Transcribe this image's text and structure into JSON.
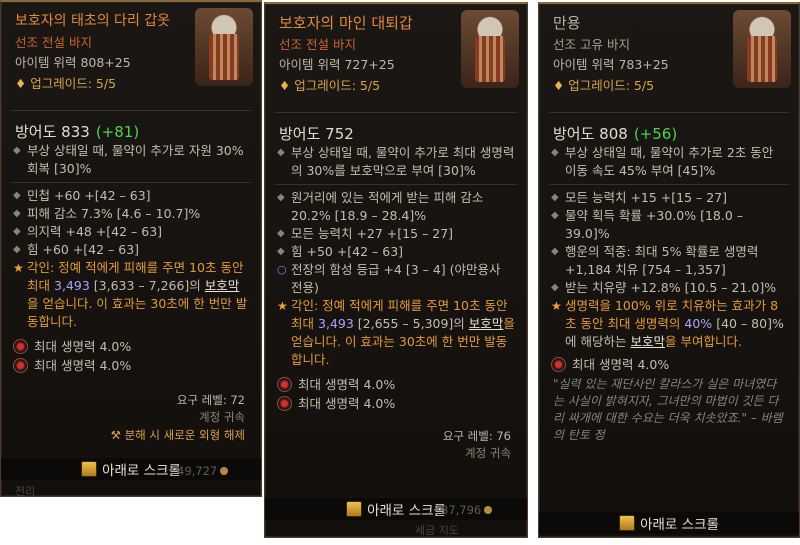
{
  "panels": [
    {
      "title": "보호자의 태초의 다리 갑옷",
      "subtitle": "선조 전설 바지",
      "item_power": "아이템 위력 808+25",
      "upgrade": "업그레이드: 5/5",
      "armor_label": "방어도 833",
      "armor_delta": "(+81)",
      "implicit": "부상 상태일 때, 물약이 추가로 자원 30% 회복 [30]%",
      "stats": [
        "민첩 +60 +[42 – 63]",
        "피해 감소 7.3% [4.6 – 10.7]%",
        "의지력 +48 +[42 – 63]",
        "힘 +60 +[42 – 63]"
      ],
      "temper_prefix": "각인: 정예 적에게 피해를 주면 10초 동안 최대",
      "temper_value": "3,493",
      "temper_range": "[3,633 – 7,266]의",
      "temper_shield": "보호막",
      "temper_suffix": "을 얻습니다. 이 효과는 30초에 한 번만 발동합니다.",
      "sockets": [
        "최대 생명력 4.0%",
        "최대 생명력 4.0%"
      ],
      "req_level": "요구 레벨: 72",
      "account_bound": "계정 귀속",
      "salvage": "분해 시 새로운 외형 해제",
      "scroll_label": "아래로 스크롤",
      "gold": "49,727"
    },
    {
      "title": "보호자의 마인 대퇴갑",
      "subtitle": "선조 전설 바지",
      "item_power": "아이템 위력 727+25",
      "upgrade": "업그레이드: 5/5",
      "armor_label": "방어도 752",
      "implicit": "부상 상태일 때, 물약이 추가로 최대 생명력의 30%를 보호막으로 부여 [30]%",
      "stats": [
        "원거리에 있는 적에게 받는 피해 감소 20.2% [18.9 – 28.4]%",
        "모든 능력치 +27 +[15 – 27]",
        "힘 +50 +[42 – 63]"
      ],
      "special_stat": "전장의 함성 등급 +4 [3 – 4] (야만용사 전용)",
      "temper_prefix": "각인: 정예 적에게 피해를 주면 10초 동안 최대",
      "temper_value": "3,493",
      "temper_range": "[2,655 – 5,309]의",
      "temper_shield": "보호막",
      "temper_suffix": "을 얻습니다. 이 효과는 30초에 한 번만 발동합니다.",
      "sockets": [
        "최대 생명력 4.0%",
        "최대 생명력 4.0%"
      ],
      "req_level": "요구 레벨: 76",
      "account_bound": "계정 귀속",
      "scroll_label": "아래로 스크롤",
      "gold": "37,796"
    },
    {
      "title": "만용",
      "subtitle": "선조 고유 바지",
      "item_power": "아이템 위력 783+25",
      "upgrade": "업그레이드: 5/5",
      "armor_label": "방어도 808",
      "armor_delta": "(+56)",
      "implicit": "부상 상태일 때, 물약이 추가로 2초 동안 이동 속도 45% 부여 [45]%",
      "stats": [
        "모든 능력치 +15 +[15 – 27]",
        "물약 획득 확률 +30.0% [18.0 – 39.0]%",
        "행운의 적중: 최대 5% 확률로 생명력 +1,184 치유 [754 – 1,357]",
        "받는 치유량 +12.8% [10.5 – 21.0]%"
      ],
      "unique_prefix": "생명력을 100% 위로 치유하는 효과가 8초 동안 최대 생명력의",
      "unique_value": "40%",
      "unique_range": "[40 – 80]%에 해당하는",
      "unique_shield": "보호막",
      "unique_suffix": "을 부여합니다.",
      "sockets": [
        "최대 생명력 4.0%"
      ],
      "flavor": "\"실력 있는 재단사인 칼라스가 실은 마녀였다는 사실이 밝혀지자, 그녀만의 마법이 깃든 다리 싸개에 대한 수요는 더욱 치솟았죠.\" – 바렘의 탄토 정",
      "scroll_label": "아래로 스크롤"
    }
  ],
  "background_fragments": {
    "p1_bottom": "전리",
    "p2_gold_hint": "세금 지도"
  },
  "icons": {
    "upgrade": "diamond-icon",
    "implicit_bullet": "diamond-bullet-icon",
    "temper_bullet": "star-icon",
    "socket": "ruby-gem-icon",
    "salvage": "hammer-icon",
    "scroll": "key-icon",
    "gold": "coin-icon"
  },
  "colors": {
    "legendary_title": "#e08a3c",
    "unique_title": "#b9b0a0",
    "stat_increase": "#4fd24f",
    "temper": "#e39a3a",
    "value_highlight": "#a9a4ff"
  }
}
